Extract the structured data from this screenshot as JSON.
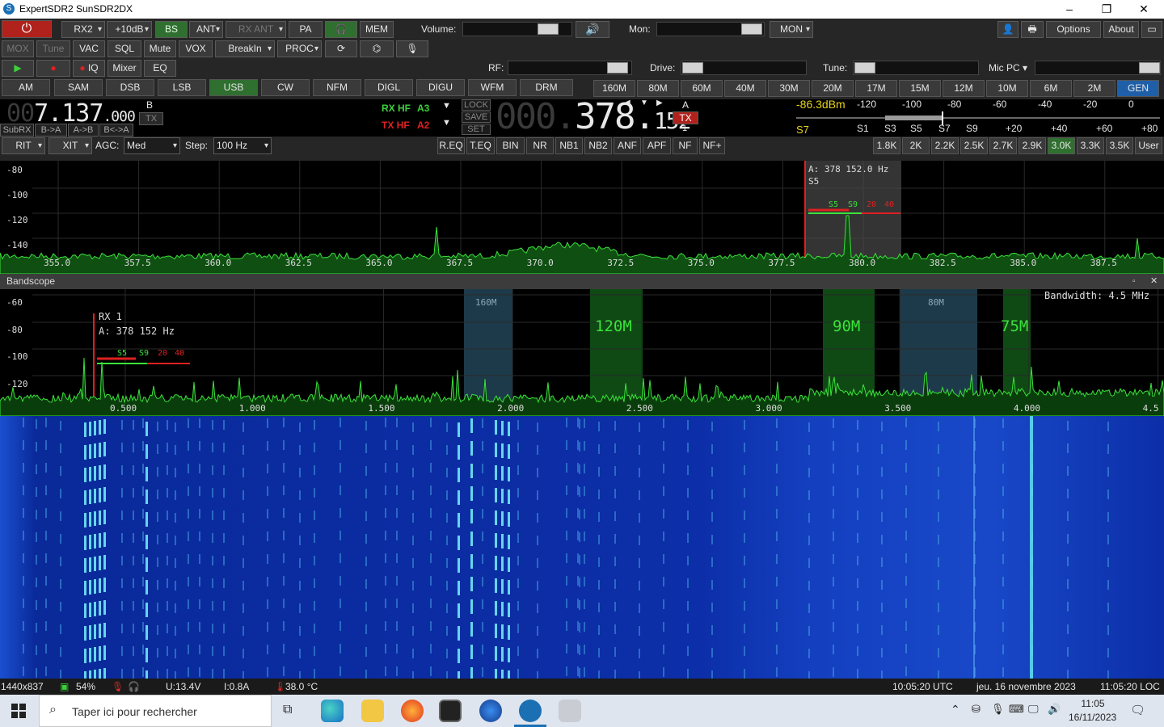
{
  "window": {
    "title": "ExpertSDR2 SunSDR2DX"
  },
  "toolbar1": {
    "power": "⏻",
    "rx2": "RX2",
    "gain": "+10dB",
    "bs": "BS",
    "ant": "ANT",
    "rx_ant": "RX ANT",
    "pa": "PA",
    "mem": "MEM",
    "volume_label": "Volume:",
    "mon_label": "Mon:",
    "mon_btn": "MON",
    "options": "Options",
    "about": "About"
  },
  "toolbar2": {
    "mox": "MOX",
    "tune": "Tune",
    "vac": "VAC",
    "sql": "SQL",
    "mute": "Mute",
    "vox": "VOX",
    "breakin": "BreakIn",
    "proc": "PROC"
  },
  "toolbar3": {
    "iq": "IQ",
    "mixer": "Mixer",
    "eq": "EQ",
    "rf_label": "RF:",
    "drive_label": "Drive:",
    "tune_label": "Tune:",
    "mic_label": "Mic PC"
  },
  "modes": [
    "AM",
    "SAM",
    "DSB",
    "LSB",
    "USB",
    "CW",
    "NFM",
    "DIGL",
    "DIGU",
    "WFM",
    "DRM"
  ],
  "active_mode": "USB",
  "bands": [
    "160M",
    "80M",
    "60M",
    "40M",
    "30M",
    "20M",
    "17M",
    "15M",
    "12M",
    "10M",
    "6M",
    "2M",
    "GEN"
  ],
  "active_band": "GEN",
  "vfo_b": {
    "freq_ghost": "00",
    "freq_main": "7.137",
    "freq_sub": ".000",
    "label": "B",
    "tx": "TX",
    "subrx": "SubRX",
    "b_to_a": "B->A",
    "a_to_b": "A->B",
    "swap": "B<->A"
  },
  "rx_info": {
    "rx": "RX HF",
    "rx_ant": "A3",
    "tx": "TX HF",
    "tx_ant": "A2",
    "lock": "LOCK",
    "save": "SAVE",
    "set": "SET"
  },
  "vfo_a": {
    "freq_ghost": "000.",
    "freq_main": "378.",
    "freq_sub": "152",
    "label": "A",
    "tx": "TX",
    "rx_num": "1"
  },
  "smeter": {
    "dbm": "-86.3dBm",
    "s_reading": "S7",
    "scale_top": [
      "-120",
      "-100",
      "-80",
      "-60",
      "-40",
      "-20",
      "0"
    ],
    "scale_bot": [
      "S1",
      "S3",
      "S5",
      "S7",
      "S9",
      "+20",
      "+40",
      "+60",
      "+80"
    ]
  },
  "controls": {
    "rit": "RIT",
    "xit": "XIT",
    "agc_label": "AGC:",
    "agc_value": "Med",
    "step_label": "Step:",
    "step_value": "100 Hz"
  },
  "dsp": [
    "R.EQ",
    "T.EQ",
    "BIN",
    "NR",
    "NB1",
    "NB2",
    "ANF",
    "APF",
    "NF",
    "NF+"
  ],
  "filters": [
    "1.8K",
    "2K",
    "2.2K",
    "2.5K",
    "2.7K",
    "2.9K",
    "3.0K",
    "3.3K",
    "3.5K",
    "User"
  ],
  "active_filter": "3.0K",
  "panadapter": {
    "db_labels": [
      "-80",
      "-100",
      "-120",
      "-140"
    ],
    "freq_labels": [
      "355.0",
      "357.5",
      "360.0",
      "362.5",
      "365.0",
      "367.5",
      "370.0",
      "372.5",
      "375.0",
      "377.5",
      "380.0",
      "382.5",
      "385.0",
      "387.5"
    ],
    "marker_text": "A: 378 152.0 Hz",
    "marker_s": "S5",
    "marker_scale": [
      "S5",
      "S9",
      "20",
      "40"
    ]
  },
  "bandscope": {
    "title": "Bandscope",
    "bandwidth": "Bandwidth: 4.5 MHz",
    "db_labels": [
      "-60",
      "-80",
      "-100",
      "-120"
    ],
    "freq_labels": [
      "0.500",
      "1.000",
      "1.500",
      "2.000",
      "2.500",
      "3.000",
      "3.500",
      "4.000",
      "4.5"
    ],
    "rx_label": "RX 1",
    "rx_freq": "A: 378 152 Hz",
    "rx_scale": [
      "S5",
      "S9",
      "20",
      "40"
    ],
    "band_regions": [
      "160M",
      "120M",
      "90M",
      "80M",
      "75M"
    ]
  },
  "status": {
    "resolution": "1440x837",
    "cpu": "54%",
    "voltage": "U:13.4V",
    "current": "I:0.8A",
    "temp": "38.0 °C",
    "utc": "10:05:20 UTC",
    "date": "jeu. 16 novembre 2023",
    "loc": "11:05:20 LOC"
  },
  "taskbar": {
    "search_placeholder": "Taper ici pour rechercher",
    "time": "11:05",
    "date": "16/11/2023"
  }
}
